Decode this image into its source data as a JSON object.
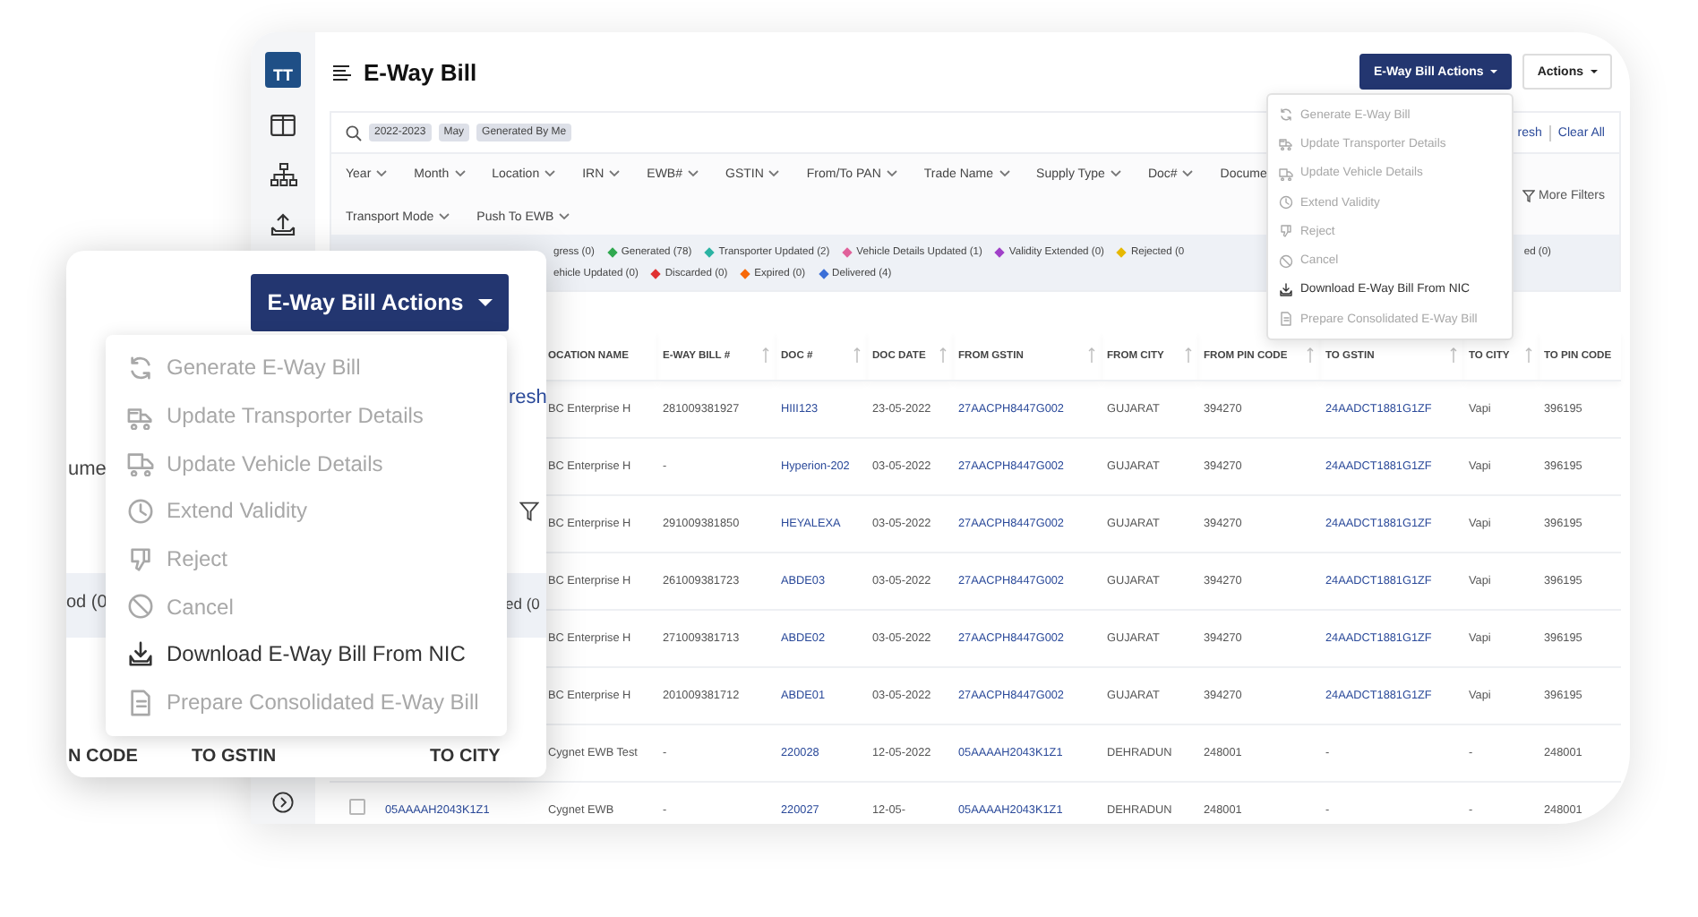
{
  "sidebar": {
    "logo": "TT"
  },
  "header": {
    "title": "E-Way Bill",
    "buttons": [
      {
        "label": "E-Way Bill Actions",
        "kind": "primary"
      },
      {
        "label": "Actions",
        "kind": "outline"
      }
    ]
  },
  "action_menu": {
    "items": [
      {
        "label": "Generate E-Way Bill",
        "disabled": true
      },
      {
        "label": "Update Transporter Details",
        "disabled": true
      },
      {
        "label": "Update Vehicle Details",
        "disabled": true
      },
      {
        "label": "Extend Validity",
        "disabled": true
      },
      {
        "label": "Reject",
        "disabled": true
      },
      {
        "label": "Cancel",
        "disabled": true
      },
      {
        "label": "Download E-Way Bill From NIC",
        "disabled": false
      },
      {
        "label": "Prepare Consolidated E-Way Bill",
        "disabled": true
      }
    ]
  },
  "search": {
    "chips": [
      "2022-2023",
      "May",
      "Generated By Me"
    ],
    "links": [
      "resh",
      "Clear All"
    ]
  },
  "filters": {
    "items": [
      {
        "label": "Year",
        "kind": "dropdown"
      },
      {
        "label": "Month",
        "kind": "dropdown"
      },
      {
        "label": "Location",
        "kind": "dropdown"
      },
      {
        "label": "IRN",
        "kind": "dropdown"
      },
      {
        "label": "EWB#",
        "kind": "dropdown"
      },
      {
        "label": "GSTIN",
        "kind": "dropdown"
      },
      {
        "label": "From/To PAN",
        "kind": "dropdown"
      },
      {
        "label": "Trade Name",
        "kind": "dropdown"
      },
      {
        "label": "Supply Type",
        "kind": "dropdown"
      },
      {
        "label": "Doc#",
        "kind": "dropdown"
      },
      {
        "label": "Docume",
        "kind": "text"
      },
      {
        "label": "Transport Mode",
        "kind": "dropdown"
      },
      {
        "label": "Push To EWB",
        "kind": "dropdown"
      }
    ],
    "more": "More Filters"
  },
  "statuses": [
    [
      {
        "label": "gress (0)"
      },
      {
        "label": "Generated (78)",
        "color": "#2fa84f"
      },
      {
        "label": "Transporter Updated (2)",
        "color": "#2bb3a3"
      },
      {
        "label": "Vehicle Details Updated (1)",
        "color": "#e0609a"
      },
      {
        "label": "Validity Extended (0)",
        "color": "#a040c8"
      },
      {
        "label": "Rejected (0",
        "color": "#e6b800"
      },
      {
        "label": "ed (0)",
        "kind": "end"
      }
    ],
    [
      {
        "label": "ehicle Updated (0)"
      },
      {
        "label": "Discarded (0)",
        "color": "#e03131"
      },
      {
        "label": "Expired (0)",
        "color": "#f76707"
      },
      {
        "label": "Delivered (4)",
        "color": "#3b6fd8"
      }
    ]
  ],
  "table": {
    "columns": [
      {
        "label": "OCATION NAME",
        "sortable": false,
        "link": false
      },
      {
        "label": "E-WAY BILL #",
        "sortable": true,
        "link": false
      },
      {
        "label": "DOC #",
        "sortable": true,
        "link": true
      },
      {
        "label": "DOC DATE",
        "sortable": true,
        "link": false
      },
      {
        "label": "FROM GSTIN",
        "sortable": true,
        "link": true
      },
      {
        "label": "FROM CITY",
        "sortable": true,
        "link": false
      },
      {
        "label": "FROM PIN CODE",
        "sortable": true,
        "link": false
      },
      {
        "label": "TO GSTIN",
        "sortable": true,
        "link": true
      },
      {
        "label": "TO CITY",
        "sortable": true,
        "link": false
      },
      {
        "label": "TO PIN CODE",
        "sortable": false,
        "link": false
      }
    ],
    "rows": [
      {
        "cells": [
          "BC Enterprise H",
          "281009381927",
          "HIII123",
          "23-05-2022",
          "27AACPH8447G002",
          "GUJARAT",
          "394270",
          "24AADCT1881G1ZF",
          "Vapi",
          "396195"
        ]
      },
      {
        "cells": [
          "BC Enterprise H",
          "-",
          "Hyperion-202",
          "03-05-2022",
          "27AACPH8447G002",
          "GUJARAT",
          "394270",
          "24AADCT1881G1ZF",
          "Vapi",
          "396195"
        ]
      },
      {
        "cells": [
          "BC Enterprise H",
          "291009381850",
          "HEYALEXA",
          "03-05-2022",
          "27AACPH8447G002",
          "GUJARAT",
          "394270",
          "24AADCT1881G1ZF",
          "Vapi",
          "396195"
        ]
      },
      {
        "cells": [
          "BC Enterprise H",
          "261009381723",
          "ABDE03",
          "03-05-2022",
          "27AACPH8447G002",
          "GUJARAT",
          "394270",
          "24AADCT1881G1ZF",
          "Vapi",
          "396195"
        ]
      },
      {
        "cells": [
          "BC Enterprise H",
          "271009381713",
          "ABDE02",
          "03-05-2022",
          "27AACPH8447G002",
          "GUJARAT",
          "394270",
          "24AADCT1881G1ZF",
          "Vapi",
          "396195"
        ]
      },
      {
        "cells": [
          "BC Enterprise H",
          "201009381712",
          "ABDE01",
          "03-05-2022",
          "27AACPH8447G002",
          "GUJARAT",
          "394270",
          "24AADCT1881G1ZF",
          "Vapi",
          "396195"
        ]
      },
      {
        "cells": [
          "Cygnet EWB Test",
          "-",
          "220028",
          "12-05-2022",
          "05AAAAH2043K1Z1",
          "DEHRADUN",
          "248001",
          "-",
          "-",
          "248001"
        ]
      },
      {
        "checked": false,
        "column_2": "05AAAAH2043K1Z1",
        "cells": [
          "Cygnet EWB",
          "-",
          "220027",
          "12-05-",
          "05AAAAH2043K1Z1",
          "DEHRADUN",
          "248001",
          "-",
          "-",
          "248001"
        ]
      }
    ]
  },
  "callout": {
    "button": "E-Way Bill Actions",
    "menu": [
      {
        "label": "Generate E-Way Bill",
        "disabled": true
      },
      {
        "label": "Update Transporter Details",
        "disabled": true
      },
      {
        "label": "Update Vehicle Details",
        "disabled": true
      },
      {
        "label": "Extend Validity",
        "disabled": true
      },
      {
        "label": "Reject",
        "disabled": true
      },
      {
        "label": "Cancel",
        "disabled": true
      },
      {
        "label": "Download E-Way Bill From NIC",
        "disabled": false
      },
      {
        "label": "Prepare Consolidated E-Way Bill",
        "disabled": true
      }
    ],
    "fragments": {
      "link": "resh",
      "filter_label": "ume",
      "status_left": "od (0",
      "status_right": "ed (0",
      "columns": [
        "N CODE",
        "TO GSTIN",
        "TO CITY"
      ]
    }
  }
}
